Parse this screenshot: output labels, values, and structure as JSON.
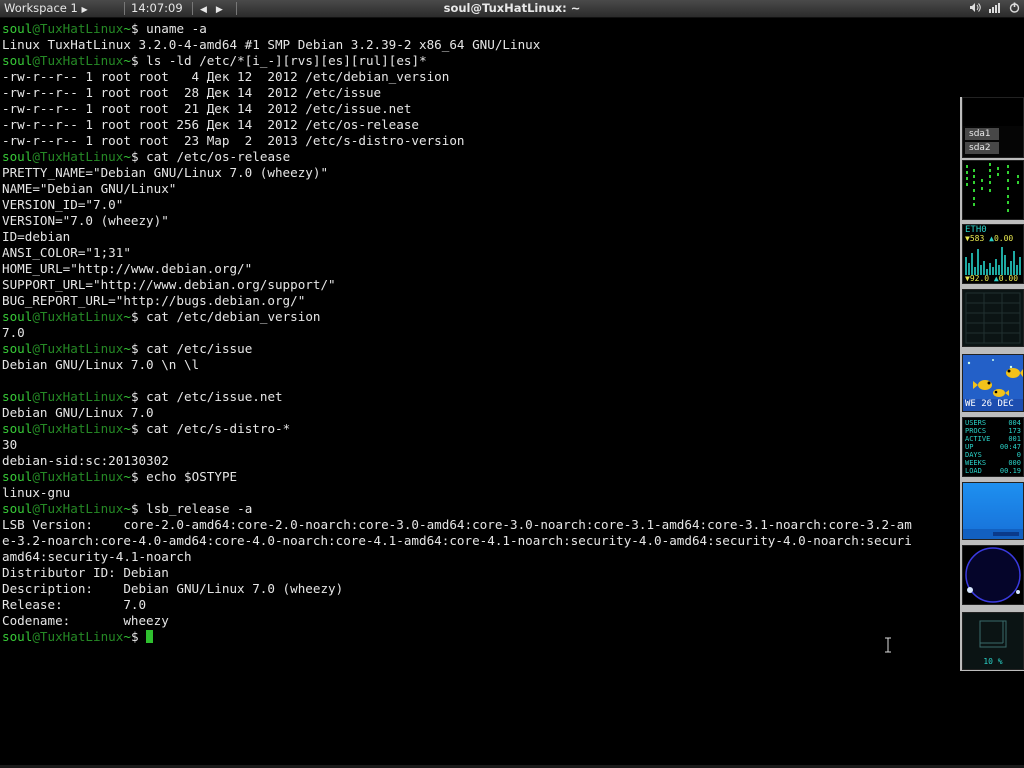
{
  "panel": {
    "workspace_label": "Workspace 1",
    "workspace_menu_icon": "triangle-right-icon",
    "clock": "14:07:09",
    "prev_symbol": "◀",
    "next_symbol": "▶",
    "window_title": "soul@TuxHatLinux: ~",
    "tray_icons": [
      "volume-icon",
      "network-icon",
      "power-icon"
    ]
  },
  "terminal": {
    "prompt_user": "soul",
    "prompt_host": "@TuxHatLinux",
    "prompt_path": "~",
    "prompt_symbol": "$",
    "lines": [
      {
        "type": "prompt",
        "cmd": "uname -a"
      },
      {
        "type": "out",
        "text": "Linux TuxHatLinux 3.2.0-4-amd64 #1 SMP Debian 3.2.39-2 x86_64 GNU/Linux"
      },
      {
        "type": "prompt",
        "cmd": "ls -ld /etc/*[i_-][rvs][es][rul][es]*"
      },
      {
        "type": "out",
        "text": "-rw-r--r-- 1 root root   4 Дек 12  2012 /etc/debian_version"
      },
      {
        "type": "out",
        "text": "-rw-r--r-- 1 root root  28 Дек 14  2012 /etc/issue"
      },
      {
        "type": "out",
        "text": "-rw-r--r-- 1 root root  21 Дек 14  2012 /etc/issue.net"
      },
      {
        "type": "out",
        "text": "-rw-r--r-- 1 root root 256 Дек 14  2012 /etc/os-release"
      },
      {
        "type": "out",
        "text": "-rw-r--r-- 1 root root  23 Мар  2  2013 /etc/s-distro-version"
      },
      {
        "type": "prompt",
        "cmd": "cat /etc/os-release"
      },
      {
        "type": "out",
        "text": "PRETTY_NAME=\"Debian GNU/Linux 7.0 (wheezy)\""
      },
      {
        "type": "out",
        "text": "NAME=\"Debian GNU/Linux\""
      },
      {
        "type": "out",
        "text": "VERSION_ID=\"7.0\""
      },
      {
        "type": "out",
        "text": "VERSION=\"7.0 (wheezy)\""
      },
      {
        "type": "out",
        "text": "ID=debian"
      },
      {
        "type": "out",
        "text": "ANSI_COLOR=\"1;31\""
      },
      {
        "type": "out",
        "text": "HOME_URL=\"http://www.debian.org/\""
      },
      {
        "type": "out",
        "text": "SUPPORT_URL=\"http://www.debian.org/support/\""
      },
      {
        "type": "out",
        "text": "BUG_REPORT_URL=\"http://bugs.debian.org/\""
      },
      {
        "type": "prompt",
        "cmd": "cat /etc/debian_version"
      },
      {
        "type": "out",
        "text": "7.0"
      },
      {
        "type": "prompt",
        "cmd": "cat /etc/issue"
      },
      {
        "type": "out",
        "text": "Debian GNU/Linux 7.0 \\n \\l"
      },
      {
        "type": "out",
        "text": ""
      },
      {
        "type": "prompt",
        "cmd": "cat /etc/issue.net"
      },
      {
        "type": "out",
        "text": "Debian GNU/Linux 7.0"
      },
      {
        "type": "prompt",
        "cmd": "cat /etc/s-distro-*"
      },
      {
        "type": "out",
        "text": "30"
      },
      {
        "type": "out",
        "text": "debian-sid:sc:20130302"
      },
      {
        "type": "prompt",
        "cmd": "echo $OSTYPE"
      },
      {
        "type": "out",
        "text": "linux-gnu"
      },
      {
        "type": "prompt",
        "cmd": "lsb_release -a"
      },
      {
        "type": "out",
        "text": "LSB Version:    core-2.0-amd64:core-2.0-noarch:core-3.0-amd64:core-3.0-noarch:core-3.1-amd64:core-3.1-noarch:core-3.2-am"
      },
      {
        "type": "out",
        "text": "e-3.2-noarch:core-4.0-amd64:core-4.0-noarch:core-4.1-amd64:core-4.1-noarch:security-4.0-amd64:security-4.0-noarch:securi"
      },
      {
        "type": "out",
        "text": "amd64:security-4.1-noarch"
      },
      {
        "type": "out",
        "text": "Distributor ID: Debian"
      },
      {
        "type": "out",
        "text": "Description:    Debian GNU/Linux 7.0 (wheezy)"
      },
      {
        "type": "out",
        "text": "Release:        7.0"
      },
      {
        "type": "out",
        "text": "Codename:       wheezy"
      },
      {
        "type": "prompt",
        "cmd": "",
        "cursor": true
      }
    ]
  },
  "dock": {
    "disk": {
      "labels": [
        "sda1",
        "sda2"
      ]
    },
    "net": {
      "iface": "ETH0",
      "rx": "583",
      "rx_rate": "0.00",
      "tx": "92.0",
      "tx_rate": "0.00"
    },
    "fish": {
      "date": "WE 26 DEC"
    },
    "stats": [
      {
        "k": "USERS",
        "v": "004"
      },
      {
        "k": "PROCS",
        "v": "173"
      },
      {
        "k": "ACTIVE",
        "v": "001"
      },
      {
        "k": "UP",
        "v": "00:47"
      },
      {
        "k": "DAYS",
        "v": "0"
      },
      {
        "k": "WEEKS",
        "v": "000"
      },
      {
        "k": "LOAD",
        "v": "00.19"
      }
    ],
    "volume": {
      "percent": "10 %"
    }
  },
  "colors": {
    "prompt_user": "#37c837",
    "prompt_host": "#258925",
    "terminal_fg": "#e6e6e6",
    "terminal_bg": "#000000",
    "panel_bg": "#3a3a3a",
    "dock_cyan": "#2ad2c8"
  }
}
